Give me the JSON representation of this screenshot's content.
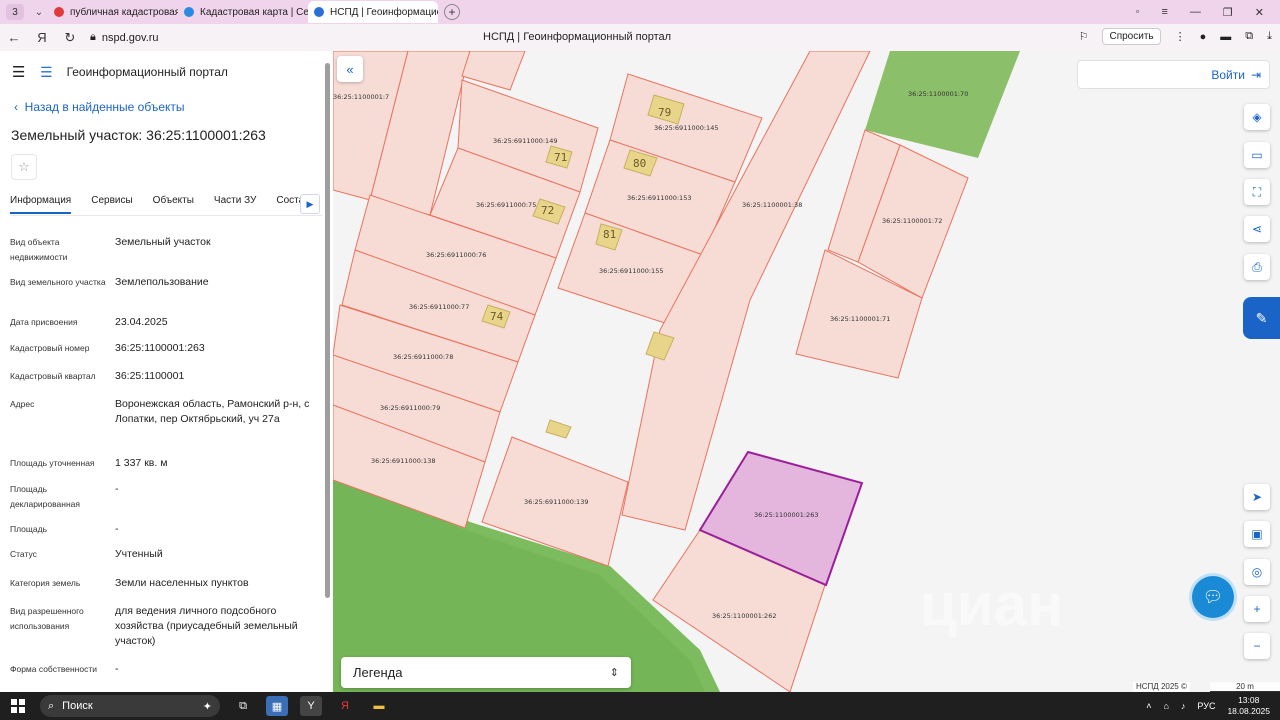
{
  "browser": {
    "tab_count": "3",
    "tabs": [
      {
        "label": "публичная кадастровая к",
        "color": "#e03a3a"
      },
      {
        "label": "Кадастровая карта | Серв",
        "color": "#2a8ae0"
      },
      {
        "label": "НСПД | Геоинформацион",
        "color": "#2a6fd6"
      }
    ],
    "url": "nspd.gov.ru",
    "page_title": "НСПД | Геоинформационный портал",
    "ask_label": "Спросить"
  },
  "panel": {
    "portal_title": "Геоинформационный портал",
    "back_label": "Назад в найденные объекты",
    "object_title": "Земельный участок: 36:25:1100001:263",
    "tabs": [
      "Информация",
      "Сервисы",
      "Объекты",
      "Части ЗУ",
      "Соста"
    ],
    "properties": [
      {
        "key": "Вид объекта недвижимости",
        "value": "Земельный участок"
      },
      {
        "key": "Вид земельного участка",
        "value": "Землепользование"
      },
      {
        "key": "Дата присвоения",
        "value": "23.04.2025"
      },
      {
        "key": "Кадастровый номер",
        "value": "36:25:1100001:263"
      },
      {
        "key": "Кадастровый квартал",
        "value": "36:25:1100001"
      },
      {
        "key": "Адрес",
        "value": "Воронежская область, Рамонский р-н, с Лопатки, пер Октябрьский, уч 27а"
      },
      {
        "key": "Площадь уточненная",
        "value": "1 337 кв. м"
      },
      {
        "key": "Площадь декларированная",
        "value": "-"
      },
      {
        "key": "Площадь",
        "value": "-"
      },
      {
        "key": "Статус",
        "value": "Учтенный"
      },
      {
        "key": "Категория земель",
        "value": "Земли населенных пунктов"
      },
      {
        "key": "Вид разрешенного использования",
        "value": "для ведения личного подсобного хозяйства (приусадебный земельный участок)"
      },
      {
        "key": "Форма собственности",
        "value": "-"
      }
    ]
  },
  "map": {
    "login_label": "Войти",
    "legend_label": "Легенда",
    "copyright": "НСПД 2025 ©",
    "scale_label": "20 m",
    "watermark": "циан",
    "parcels": [
      {
        "label": "36:25:1100001:7"
      },
      {
        "label": "36:25:6911000:149"
      },
      {
        "label": "36:25:6911000:145"
      },
      {
        "label": "36:25:6911000:153"
      },
      {
        "label": "36:25:6911000:75"
      },
      {
        "label": "36:25:6911000:76"
      },
      {
        "label": "36:25:6911000:155"
      },
      {
        "label": "36:25:6911000:77"
      },
      {
        "label": "36:25:6911000:78"
      },
      {
        "label": "36:25:6911000:79"
      },
      {
        "label": "36:25:6911000:138"
      },
      {
        "label": "36:25:6911000:139"
      },
      {
        "label": "36:25:1100001:38"
      },
      {
        "label": "36:25:1100001:70"
      },
      {
        "label": "36:25:1100001:72"
      },
      {
        "label": "36:25:1100001:71"
      },
      {
        "label": "36:25:1100001:263"
      },
      {
        "label": "36:25:1100001:262"
      }
    ],
    "buildings": [
      "79",
      "80",
      "71",
      "72",
      "81",
      "74"
    ]
  },
  "taskbar": {
    "search_label": "Поиск",
    "lang": "РУС",
    "time": "13:08",
    "date": "18.08.2025"
  }
}
